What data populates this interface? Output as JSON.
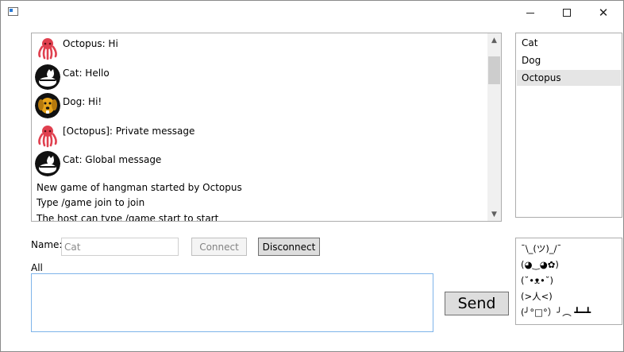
{
  "window": {
    "icon": "app-window-icon",
    "controls": [
      "minimize-icon",
      "maximize-icon",
      "close-icon"
    ]
  },
  "chat": {
    "messages": [
      {
        "avatar": "octopus-avatar",
        "text": "Octopus: Hi"
      },
      {
        "avatar": "cat-avatar",
        "text": "Cat: Hello"
      },
      {
        "avatar": "dog-avatar",
        "text": "Dog: Hi!"
      },
      {
        "avatar": "octopus-avatar",
        "text": "[Octopus]: Private message"
      },
      {
        "avatar": "cat-avatar",
        "text": "Cat: Global message"
      }
    ],
    "system_lines": [
      "New game of hangman started by Octopus",
      "Type /game join to join",
      "The host can type /game start to start"
    ]
  },
  "users": {
    "items": [
      "Cat",
      "Dog",
      "Octopus"
    ],
    "selected": "Octopus"
  },
  "connection": {
    "name_label": "Name:",
    "name_value": "Cat",
    "connect_label": "Connect",
    "disconnect_label": "Disconnect"
  },
  "compose": {
    "target_label": "All",
    "message_value": "",
    "send_label": "Send"
  },
  "emoticons": {
    "items": [
      "¯\\_(ツ)_/¯",
      "(◕‿◕✿)",
      "(˘•ᴥ•˘)",
      "(>人<)",
      "(╯°□°）╯︵ ┻━┻"
    ]
  },
  "colors": {
    "octopus": "#e0404f",
    "dog": "#e8a51c",
    "focus_border": "#7eb4ea",
    "selection": "#e5e5e5"
  }
}
